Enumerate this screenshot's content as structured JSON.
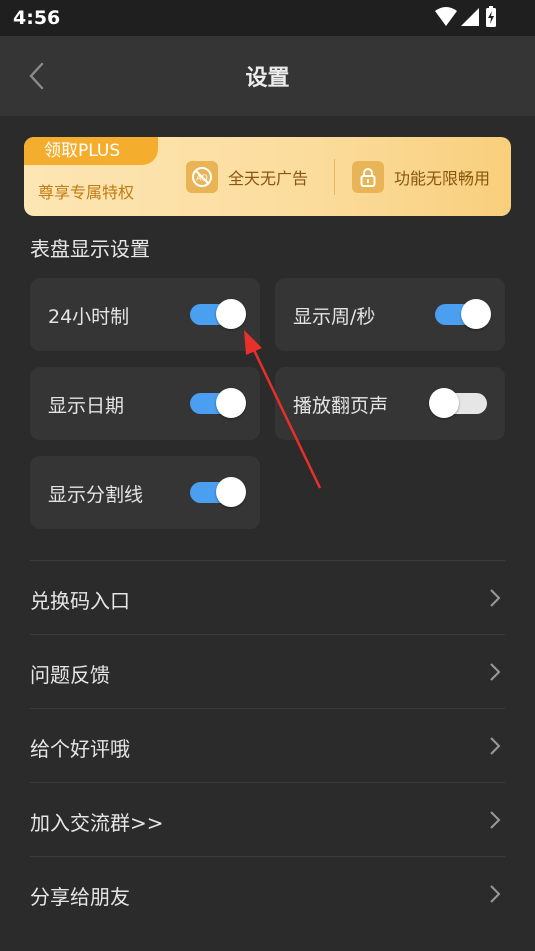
{
  "status_bar": {
    "time": "4:56"
  },
  "header": {
    "title": "设置",
    "back_icon": "chevron-left-icon"
  },
  "plus_banner": {
    "badge": "领取PLUS",
    "subtitle": "尊享专属特权",
    "features": [
      {
        "icon": "no-ads-icon",
        "label": "全天无广告"
      },
      {
        "icon": "lock-icon",
        "label": "功能无限畅用"
      }
    ]
  },
  "dial_settings": {
    "title": "表盘显示设置",
    "toggles": [
      {
        "label": "24小时制",
        "on": true
      },
      {
        "label": "显示周/秒",
        "on": true
      },
      {
        "label": "显示日期",
        "on": true
      },
      {
        "label": "播放翻页声",
        "on": false
      },
      {
        "label": "显示分割线",
        "on": true
      }
    ]
  },
  "menu": [
    {
      "label": "兑换码入口"
    },
    {
      "label": "问题反馈"
    },
    {
      "label": "给个好评哦"
    },
    {
      "label": "加入交流群>>"
    },
    {
      "label": "分享给朋友"
    }
  ],
  "colors": {
    "accent_toggle": "#4a9ff0",
    "banner_badge": "#f5ad2e",
    "annotation_arrow": "#e8302a"
  }
}
